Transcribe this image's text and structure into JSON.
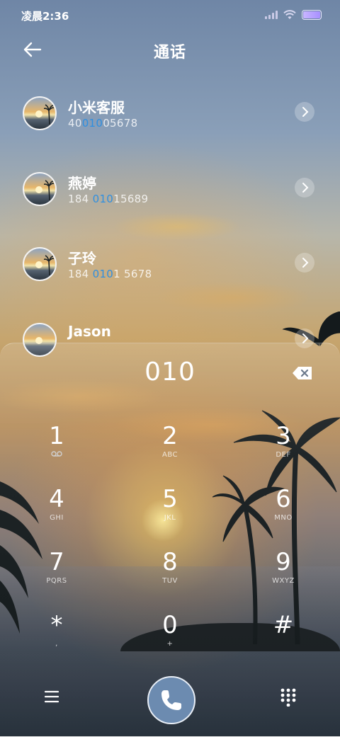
{
  "status_bar": {
    "time": "凌晨2:36"
  },
  "header": {
    "title": "通话"
  },
  "contacts": [
    {
      "name": "小米客服",
      "num_pre": "40",
      "num_hl": "010",
      "num_post": "05678"
    },
    {
      "name": "燕婷",
      "num_pre": "184 ",
      "num_hl": "010",
      "num_post": "15689"
    },
    {
      "name": "子玲",
      "num_pre": "184 ",
      "num_hl": "010",
      "num_post": "1 5678"
    },
    {
      "name": "Jason",
      "num_pre": "",
      "num_hl": "",
      "num_post": ""
    }
  ],
  "dialpad": {
    "entry": "010",
    "keys": [
      {
        "digit": "1",
        "letters": ""
      },
      {
        "digit": "2",
        "letters": "ABC"
      },
      {
        "digit": "3",
        "letters": "DEF"
      },
      {
        "digit": "4",
        "letters": "GHI"
      },
      {
        "digit": "5",
        "letters": "JKL"
      },
      {
        "digit": "6",
        "letters": "MNO"
      },
      {
        "digit": "7",
        "letters": "PQRS"
      },
      {
        "digit": "8",
        "letters": "TUV"
      },
      {
        "digit": "9",
        "letters": "WXYZ"
      },
      {
        "digit": "*",
        "letters": ","
      },
      {
        "digit": "0",
        "letters": "+"
      },
      {
        "digit": "#",
        "letters": ""
      }
    ]
  },
  "colors": {
    "highlight": "#2f8fe0",
    "call_button": "#6c8bb0"
  }
}
